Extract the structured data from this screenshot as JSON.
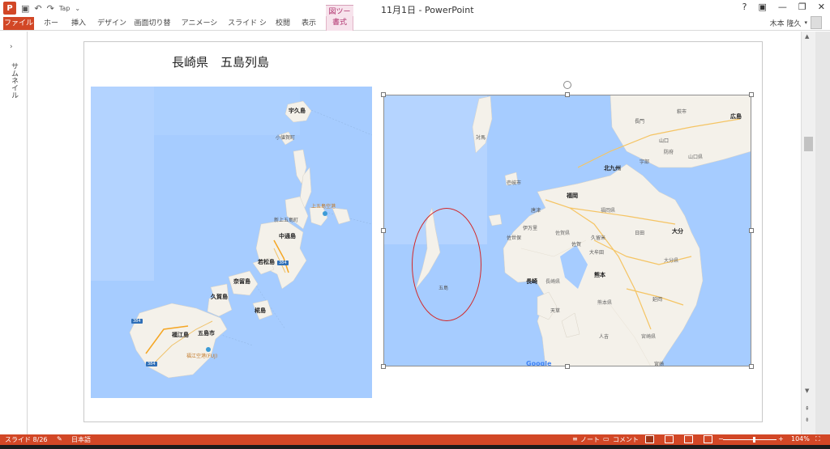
{
  "window": {
    "title": "11月1日 - PowerPoint",
    "logo": "P",
    "controls": [
      "?",
      "▣",
      "—",
      "❐",
      "✕"
    ]
  },
  "qat": {
    "touch": "Tap"
  },
  "ribbon": {
    "context_header": "図ツール",
    "tabs": [
      "ファイル",
      "ホーム",
      "挿入",
      "デザイン",
      "画面切り替え",
      "アニメーション",
      "スライド ショー",
      "校閲",
      "表示",
      "書式"
    ],
    "user": "木本 隆久"
  },
  "thumbnails": {
    "label": "サムネイル",
    "toggle": "›"
  },
  "slide": {
    "title": "長崎県　五島列島"
  },
  "map_left": {
    "labels": [
      "宇久島",
      "小値賀町",
      "上五島空港",
      "新上五島町",
      "中通島",
      "若松島",
      "奈留島",
      "久賀島",
      "椛島",
      "福江島",
      "五島市",
      "福江空港(FUJ)"
    ],
    "roads": [
      "384",
      "384",
      "384"
    ]
  },
  "map_right": {
    "labels": [
      "広島",
      "山口",
      "長門",
      "萩市",
      "防府",
      "山口県",
      "宇部",
      "対馬",
      "壱岐市",
      "北九州",
      "福岡",
      "福岡県",
      "唐津",
      "久留米",
      "佐賀",
      "佐賀県",
      "伊万里",
      "佐世保",
      "大分",
      "大分県",
      "日田",
      "長崎",
      "長崎県",
      "大牟田",
      "熊本",
      "熊本県",
      "天草",
      "人吉",
      "延岡",
      "宮崎県",
      "宮崎",
      "五島"
    ],
    "google": "Google"
  },
  "status": {
    "slide": "スライド 8/26",
    "language": "日本語",
    "notes": "ノート",
    "comments": "コメント",
    "zoom": "104%",
    "minus": "−",
    "plus": "+"
  },
  "colors": {
    "accent": "#d24726",
    "sea": "#a6ccff",
    "land": "#f4f1ea",
    "annotation": "#d32626"
  }
}
